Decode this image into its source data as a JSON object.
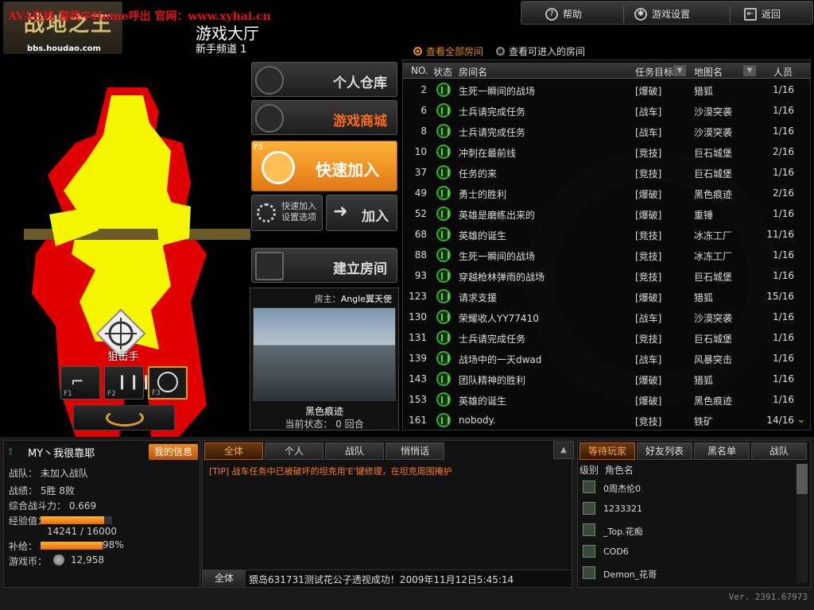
{
  "watermark": {
    "text": "AVA在线 游戏中Home呼出 官网：www.xyhai.cn",
    "logo": "战地之王",
    "url": "bbs.houdao.com"
  },
  "header": {
    "title": "游戏大厅",
    "channel": "新手频道 1"
  },
  "topbar": {
    "help": "帮助",
    "settings": "游戏设置",
    "back": "返回"
  },
  "filters": {
    "all": "查看全部房间",
    "enterable": "查看可进入的房间",
    "selected": "all"
  },
  "menu": {
    "warehouse": "个人仓库",
    "shop": "游戏商城",
    "quick_join": "快速加入",
    "quick_key": "F5",
    "quick_settings": "快速加入设置选项",
    "join": "加入",
    "create_room": "建立房间"
  },
  "preview": {
    "host_label": "房主：",
    "host": "Angle翼天使",
    "map": "黑色痕迹",
    "status": "当前状态： 0 回合"
  },
  "character": {
    "class": "狙击手",
    "weapon_keys": [
      "F1",
      "F2",
      "F3"
    ],
    "selected_weapon": 2
  },
  "room_table": {
    "headers": {
      "no": "NO.",
      "status": "状态",
      "name": "房间名",
      "mode": "任务目标",
      "map": "地图名",
      "players": "人员"
    },
    "rows": [
      {
        "no": "2",
        "name": "生死一瞬间的战场",
        "mode": "[爆破]",
        "map": "猎狐",
        "players": "1/16"
      },
      {
        "no": "6",
        "name": "士兵请完成任务",
        "mode": "[战车]",
        "map": "沙漠突袭",
        "players": "1/16"
      },
      {
        "no": "8",
        "name": "士兵请完成任务",
        "mode": "[战车]",
        "map": "沙漠突袭",
        "players": "1/16"
      },
      {
        "no": "10",
        "name": "冲刺在最前线",
        "mode": "[竞技]",
        "map": "巨石城堡",
        "players": "2/16"
      },
      {
        "no": "37",
        "name": "任务的来",
        "mode": "[竞技]",
        "map": "巨石城堡",
        "players": "1/16"
      },
      {
        "no": "49",
        "name": "勇士的胜利",
        "mode": "[爆破]",
        "map": "黑色痕迹",
        "players": "2/16"
      },
      {
        "no": "52",
        "name": "英雄是磨练出来的",
        "mode": "[爆破]",
        "map": "重锤",
        "players": "1/16"
      },
      {
        "no": "68",
        "name": "英雄的诞生",
        "mode": "[竞技]",
        "map": "冰冻工厂",
        "players": "11/16"
      },
      {
        "no": "88",
        "name": "生死一瞬间的战场",
        "mode": "[竞技]",
        "map": "冰冻工厂",
        "players": "1/16"
      },
      {
        "no": "93",
        "name": "穿越枪林弹雨的战场",
        "mode": "[竞技]",
        "map": "巨石城堡",
        "players": "1/16"
      },
      {
        "no": "123",
        "name": "请求支援",
        "mode": "[爆破]",
        "map": "猎狐",
        "players": "15/16"
      },
      {
        "no": "130",
        "name": "荣耀收人YY77410",
        "mode": "[战车]",
        "map": "沙漠突袭",
        "players": "1/16"
      },
      {
        "no": "131",
        "name": "士兵请完成任务",
        "mode": "[竞技]",
        "map": "巨石城堡",
        "players": "1/16"
      },
      {
        "no": "139",
        "name": "战场中的一天dwad",
        "mode": "[战车]",
        "map": "风暴突击",
        "players": "1/16"
      },
      {
        "no": "143",
        "name": "团队精神的胜利",
        "mode": "[爆破]",
        "map": "猎狐",
        "players": "1/16"
      },
      {
        "no": "153",
        "name": "英雄的诞生",
        "mode": "[爆破]",
        "map": "黑色痕迹",
        "players": "1/16"
      },
      {
        "no": "161",
        "name": "nobody.",
        "mode": "[竞技]",
        "map": "铁矿",
        "players": "14/16"
      }
    ]
  },
  "player": {
    "name": "MY丶我很靠耶",
    "my_info_tab": "我的信息",
    "clan": "战队：  未加入战队",
    "record": "战绩：  5胜 8败",
    "power": "综合战斗力：  0.669",
    "exp_label": "经验值：",
    "exp_value": "14241 / 16000",
    "exp_fraction": 0.89,
    "supply_label": "补给：",
    "supply_value": "98%",
    "supply_fraction": 0.98,
    "coin_label": "游戏币：",
    "coins": "12,958"
  },
  "chat": {
    "tabs": [
      "全体",
      "个人",
      "战队",
      "悄悄话"
    ],
    "active_tab": 0,
    "messages": [
      "[TIP] 战车任务中已被破坏的坦克用'E'键修理，在坦克周围掩护"
    ],
    "channel": "全体",
    "input_value": "猥岛631731测试花公子透视成功！2009年11月12日5:45:14"
  },
  "players": {
    "tabs": [
      "等待玩家",
      "好友列表",
      "黑名单",
      "战队"
    ],
    "active_tab": 0,
    "header_rank": "级别",
    "header_name": "角色名",
    "list": [
      "0周杰伦0",
      "1233321",
      "_Top.花痴",
      "COD6",
      "Demon_花哥"
    ]
  },
  "version": "Ver. 2391.67973",
  "colors": {
    "accent": "#e08b1d",
    "ready": "#3aaa2e",
    "tip": "#ff7d2a",
    "silhouette_red": "#e00000",
    "silhouette_yellow": "#f5f500"
  }
}
